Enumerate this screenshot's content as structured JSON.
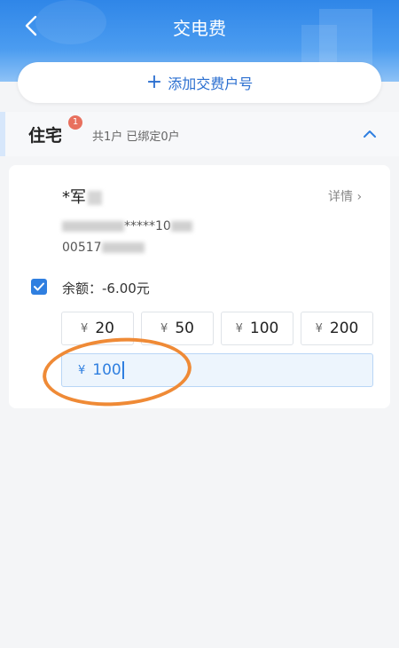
{
  "header": {
    "title": "交电费"
  },
  "add_account": {
    "label": "添加交费户号"
  },
  "section": {
    "title": "住宅",
    "badge": "1",
    "subtitle": "共1户 已绑定0户"
  },
  "account": {
    "name": "*军",
    "detail_label": "详情",
    "line1": "*****10",
    "line2": "00517"
  },
  "balance": {
    "label": "余额：-6.00元",
    "checked": true
  },
  "amounts": [
    {
      "symbol": "¥",
      "value": "20"
    },
    {
      "symbol": "¥",
      "value": "50"
    },
    {
      "symbol": "¥",
      "value": "100"
    },
    {
      "symbol": "¥",
      "value": "200"
    }
  ],
  "custom_amount": {
    "symbol": "¥",
    "value": "100"
  },
  "colors": {
    "primary": "#2f7fe0",
    "header": "#3a8fe9",
    "annotation": "#ef8a36"
  }
}
